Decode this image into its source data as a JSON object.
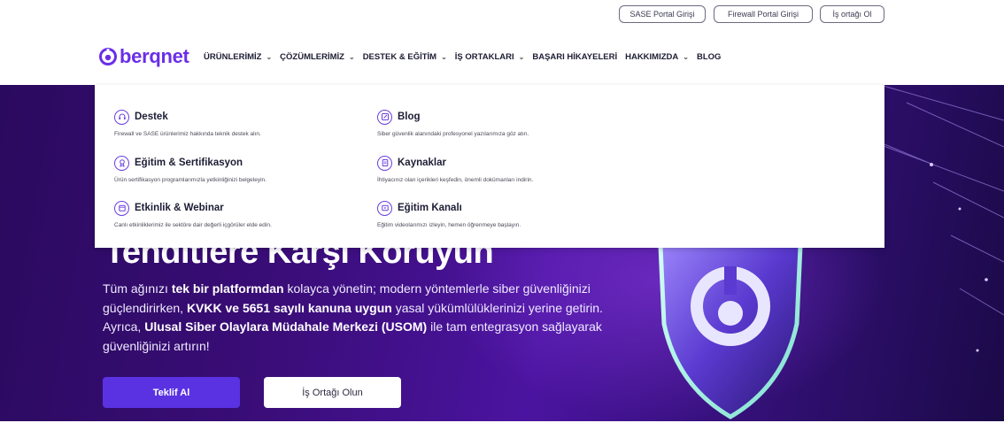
{
  "top_links": [
    "SASE Portal Girişi",
    "Firewall Portal Girişi",
    "İş ortağı Ol"
  ],
  "logo": {
    "text": "berqnet"
  },
  "nav": {
    "items": [
      {
        "label": "ÜRÜNLERİMİZ",
        "has_dropdown": true
      },
      {
        "label": "ÇÖZÜMLERİMİZ",
        "has_dropdown": true
      },
      {
        "label": "DESTEK & EĞİTİM",
        "has_dropdown": true
      },
      {
        "label": "İŞ ORTAKLARI",
        "has_dropdown": true
      },
      {
        "label": "BAŞARI HİKAYELERİ",
        "has_dropdown": false
      },
      {
        "label": "HAKKIMIZDA",
        "has_dropdown": true
      },
      {
        "label": "BLOG",
        "has_dropdown": false
      }
    ]
  },
  "dropdown": {
    "items": [
      {
        "icon": "headset-icon",
        "title": "Destek",
        "desc": "Firewall ve SASE ürünlerimiz hakkında teknik destek alın."
      },
      {
        "icon": "edit-icon",
        "title": "Blog",
        "desc": "Siber güvenlik alanındaki profesyonel yazılarımıza göz atın."
      },
      {
        "icon": "certificate-icon",
        "title": "Eğitim & Sertifikasyon",
        "desc": "Ürün sertifikasyon programlarımızla yetkinliğinizi belgeleyin."
      },
      {
        "icon": "document-icon",
        "title": "Kaynaklar",
        "desc": "İhtiyacınız olan içerikleri keşfedin, önemli dokümanları indirin."
      },
      {
        "icon": "calendar-icon",
        "title": "Etkinlik & Webinar",
        "desc": "Canlı etkinliklerimiz ile sektöre dair değerli içgörüler elde edin."
      },
      {
        "icon": "video-icon",
        "title": "Eğitim Kanalı",
        "desc": "Eğitim videolarımızı izleyin, hemen öğrenmeye başlayın."
      }
    ]
  },
  "hero": {
    "title": "Tehditlere Karşı Koruyun",
    "desc_parts": [
      {
        "text": "Tüm ağınızı ",
        "bold": false
      },
      {
        "text": "tek bir platformdan",
        "bold": true
      },
      {
        "text": " kolayca yönetin; modern yöntemlerle siber güvenliğinizi güçlendirirken, ",
        "bold": false
      },
      {
        "text": "KVKK ve 5651 sayılı kanuna uygun",
        "bold": true
      },
      {
        "text": " yasal yükümlülüklerinizi yerine getirin. Ayrıca, ",
        "bold": false
      },
      {
        "text": "Ulusal Siber Olaylara Müdahale Merkezi (USOM)",
        "bold": true
      },
      {
        "text": " ile tam entegrasyon sağlayarak güvenliğinizi artırın!",
        "bold": false
      }
    ],
    "primary_button": "Teklif Al",
    "secondary_button": "İş Ortağı Olun"
  },
  "colors": {
    "brand": "#6a2ee8",
    "button": "#5a32e2",
    "hero_bg": "#3a0d78"
  }
}
